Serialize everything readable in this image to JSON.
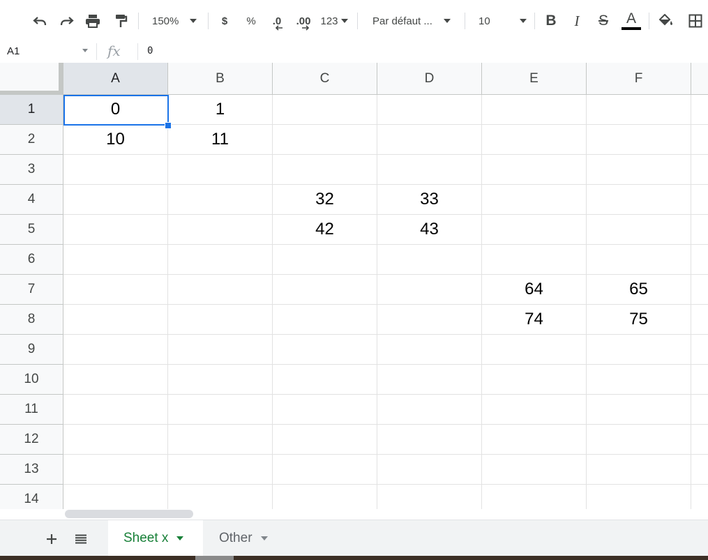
{
  "toolbar": {
    "zoom": "150%",
    "currency": "$",
    "percent": "%",
    "decrease_decimal": ".0",
    "increase_decimal": ".00",
    "number_format": "123",
    "font": "Par défaut ...",
    "font_size": "10",
    "bold": "B",
    "italic": "I",
    "strike": "S",
    "text_color_letter": "A",
    "text_color": "#000000"
  },
  "formula_bar": {
    "name_box": "A1",
    "fx": "fx",
    "value": "0"
  },
  "columns": [
    "A",
    "B",
    "C",
    "D",
    "E",
    "F"
  ],
  "rows": [
    "1",
    "2",
    "3",
    "4",
    "5",
    "6",
    "7",
    "8",
    "9",
    "10",
    "11",
    "12",
    "13",
    "14"
  ],
  "cells": {
    "A1": "0",
    "B1": "1",
    "A2": "10",
    "B2": "11",
    "C4": "32",
    "D4": "33",
    "C5": "42",
    "D5": "43",
    "E7": "64",
    "F7": "65",
    "E8": "74",
    "F8": "75"
  },
  "selected_cell": "A1",
  "sheet_tabs": [
    {
      "label": "Sheet x",
      "active": true
    },
    {
      "label": "Other",
      "active": false
    }
  ],
  "colors": {
    "accent": "#1a73e8",
    "active_tab_text": "#188038"
  }
}
